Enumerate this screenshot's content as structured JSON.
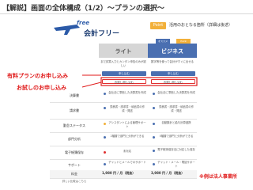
{
  "page": {
    "title": "【解説】画面の全体構成（1/2）～プランの選択～",
    "note": "※例は法人事業所"
  },
  "logo": {
    "script_text": "free",
    "name": "会計フリー"
  },
  "point": {
    "badge": "Point",
    "text": "活用のおとなる箇所（詳細は後述）"
  },
  "plans": {
    "top_badge_left": "オススメ",
    "top_badge_right": "Point",
    "columns": [
      "ライト",
      "ビジネス"
    ],
    "intro": [
      "まだ試算入力とカンタン申告のみが欲しい",
      "数字等を使って会計がすぐに出せる"
    ],
    "apply_label": "申し込む",
    "trial_label": "お試し申し込む",
    "rows": [
      {
        "label": "決算書",
        "lite": "会社法に準拠した決算書を作成",
        "biz": "会社法に準拠した決算書を作成"
      },
      {
        "label": "請求書",
        "lite": "見積書・請求書・納品書の作成・発送",
        "biz": "見積書・請求書・納品書の作成・発送"
      },
      {
        "label": "勤怠ステータス",
        "lite": "アシスタントによる管理サポート",
        "biz": "自動集計と給与計算連携"
      },
      {
        "label": "部門分析",
        "lite": "2階層で部門と分析ができる",
        "biz": "5階層で部門と分析ができる"
      },
      {
        "label": "電子帳簿保存",
        "lite": "未対応",
        "biz": "電子帳簿保存法に対応した保存"
      },
      {
        "label": "サポート",
        "lite": "チャットとメールでのサポート",
        "biz": "チャット・メール・電話サポート"
      }
    ],
    "price_label": "料金",
    "price_lite": "1,980 円 / 月（税抜）",
    "price_biz": "3,980 円 / 月（税抜）",
    "footer_label": "詳しい比較はこちら"
  },
  "annotations": {
    "apply": "有料プランのお申し込み",
    "trial": "お試しのお申し込み"
  },
  "colors": {
    "accent_blue": "#4a6fb1",
    "point_orange": "#f2b03a",
    "annotation_red": "#e01a1a"
  }
}
